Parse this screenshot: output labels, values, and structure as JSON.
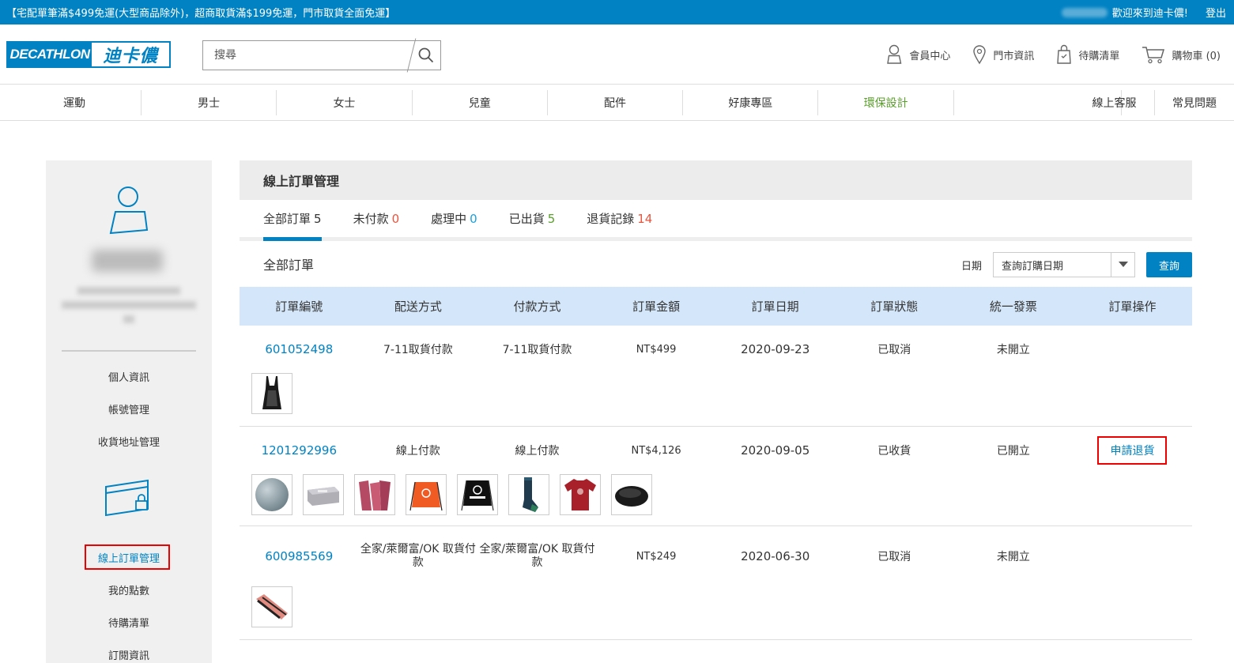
{
  "topbar": {
    "promo": "【宅配單筆滿$499免運(大型商品除外)，超商取貨滿$199免運，門市取貨全面免運】",
    "welcome": "歡迎來到迪卡儂!",
    "logout": "登出"
  },
  "header": {
    "logo_en": "DECATHLON",
    "logo_zh": "迪卡儂",
    "search_placeholder": "搜尋",
    "nav": {
      "member": "會員中心",
      "store": "門市資訊",
      "wishlist": "待購清單",
      "cart": "購物車 (0)"
    }
  },
  "categories": [
    "運動",
    "男士",
    "女士",
    "兒童",
    "配件",
    "好康專區",
    "環保設計"
  ],
  "category_right": [
    "線上客服",
    "常見問題"
  ],
  "sidebar": {
    "links_top": [
      "個人資訊",
      "帳號管理",
      "收貨地址管理"
    ],
    "links_bottom": [
      "線上訂單管理",
      "我的點數",
      "待購清單",
      "訂閱資訊"
    ]
  },
  "main": {
    "title": "線上訂單管理",
    "tabs": [
      {
        "label": "全部訂單",
        "count": "5",
        "color": "#333333"
      },
      {
        "label": "未付款",
        "count": "0",
        "color": "#e8553e"
      },
      {
        "label": "處理中",
        "count": "0",
        "color": "#1aa0e0"
      },
      {
        "label": "已出貨",
        "count": "5",
        "color": "#5aa02c"
      },
      {
        "label": "退貨記錄",
        "count": "14",
        "color": "#e8553e"
      }
    ],
    "section_title": "全部訂單",
    "date_label": "日期",
    "date_select": "查詢訂購日期",
    "query_button": "查詢",
    "columns": [
      "訂單編號",
      "配送方式",
      "付款方式",
      "訂單金額",
      "訂單日期",
      "訂單狀態",
      "統一發票",
      "訂單操作"
    ],
    "orders": [
      {
        "id": "601052498",
        "shipping": "7-11取貨付款",
        "payment": "7-11取貨付款",
        "amount": "NT$499",
        "date": "2020-09-23",
        "status": "已取消",
        "invoice": "未開立",
        "action": ""
      },
      {
        "id": "1201292996",
        "shipping": "線上付款",
        "payment": "線上付款",
        "amount": "NT$4,126",
        "date": "2020-09-05",
        "status": "已收貨",
        "invoice": "已開立",
        "action": "申請退貨"
      },
      {
        "id": "600985569",
        "shipping": "全家/萊爾富/OK 取貨付款",
        "payment": "全家/萊爾富/OK 取貨付款",
        "amount": "NT$249",
        "date": "2020-06-30",
        "status": "已取消",
        "invoice": "未開立",
        "action": ""
      }
    ],
    "thumbnails": {
      "order1": [
        "swimsuit-icon"
      ],
      "order2": [
        "gym-ball-icon",
        "yoga-block-icon",
        "resistance-band-icon",
        "drawstring-bag-orange-icon",
        "drawstring-bag-black-icon",
        "sock-icon",
        "tshirt-icon",
        "balance-disc-icon"
      ],
      "order3": [
        "resistance-loop-icon"
      ]
    }
  }
}
